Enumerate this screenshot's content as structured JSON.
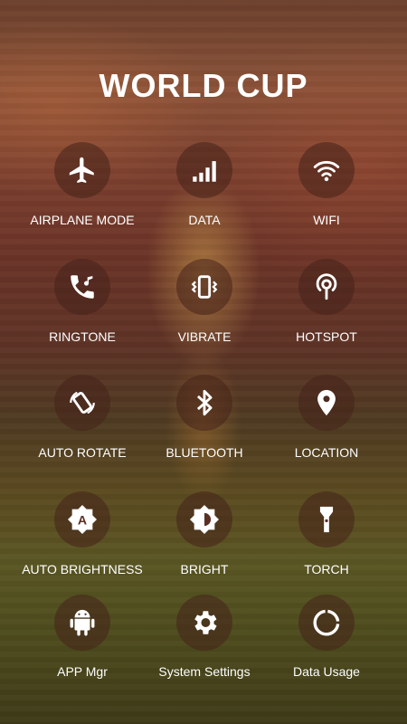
{
  "title": "WORLD CUP",
  "toggles": [
    {
      "label": "AIRPLANE MODE",
      "icon": "airplane-icon"
    },
    {
      "label": "DATA",
      "icon": "signal-bars-icon"
    },
    {
      "label": "WIFI",
      "icon": "wifi-icon"
    },
    {
      "label": "RINGTONE",
      "icon": "phone-ring-icon"
    },
    {
      "label": "VIBRATE",
      "icon": "vibrate-icon"
    },
    {
      "label": "HOTSPOT",
      "icon": "hotspot-icon"
    },
    {
      "label": "AUTO ROTATE",
      "icon": "rotate-icon"
    },
    {
      "label": "BLUETOOTH",
      "icon": "bluetooth-icon"
    },
    {
      "label": "LOCATION",
      "icon": "location-pin-icon"
    },
    {
      "label": "AUTO BRIGHTNESS",
      "icon": "auto-brightness-icon"
    },
    {
      "label": "BRIGHT",
      "icon": "brightness-icon"
    },
    {
      "label": "TORCH",
      "icon": "torch-icon"
    },
    {
      "label": "APP Mgr",
      "icon": "android-icon"
    },
    {
      "label": "System Settings",
      "icon": "gear-icon"
    },
    {
      "label": "Data Usage",
      "icon": "data-usage-icon"
    }
  ]
}
